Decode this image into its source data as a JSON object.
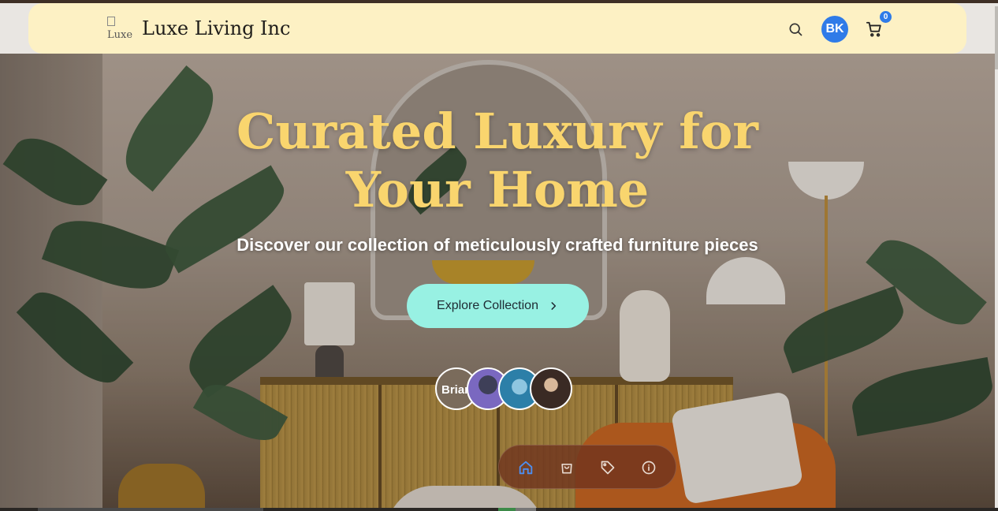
{
  "navbar": {
    "logo_alt": "Luxe",
    "brand": "Luxe Living Inc",
    "search_icon": "search-icon",
    "avatar_initials": "BK",
    "cart_icon": "cart-icon",
    "cart_count": "0"
  },
  "hero": {
    "title_line1": "Curated Luxury for",
    "title_line2": "Your Home",
    "subtitle": "Discover our collection of meticulously crafted furniture pieces",
    "cta_label": "Explore Collection",
    "cta_icon": "chevron-right-icon"
  },
  "people": [
    {
      "name": "Brian",
      "alt_text": "Brian"
    },
    {
      "icon": "avatar-2"
    },
    {
      "icon": "avatar-3"
    },
    {
      "icon": "avatar-4"
    }
  ],
  "dock": {
    "items": [
      {
        "icon": "home-icon",
        "active": true
      },
      {
        "icon": "shopping-bag-icon"
      },
      {
        "icon": "tag-icon"
      },
      {
        "icon": "info-icon"
      }
    ]
  },
  "colors": {
    "navbar_bg": "#fdf1c4",
    "title": "#f9d56e",
    "cta_bg": "#98f1e3",
    "accent_blue": "#2f7be8",
    "dock_bg": "#6e321e"
  }
}
